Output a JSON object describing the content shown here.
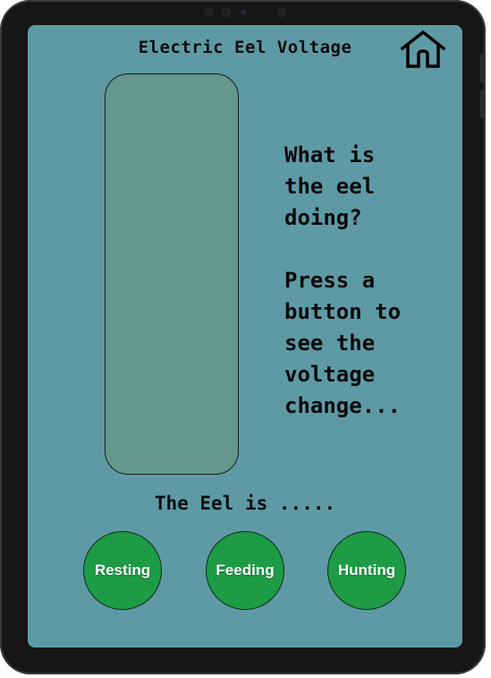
{
  "app": {
    "title": "Electric Eel Voltage",
    "home_icon": "home-icon"
  },
  "prompt": {
    "text": "What is\nthe eel\ndoing?\n\nPress a\nbutton to\nsee the\nvoltage\nchange..."
  },
  "status": {
    "text": "The Eel is ....."
  },
  "buttons": [
    {
      "label": "Resting"
    },
    {
      "label": "Feeding"
    },
    {
      "label": "Hunting"
    }
  ],
  "colors": {
    "screen_bg": "#5e9aa5",
    "meter_fill": "#64988a",
    "button_green": "#1d9b45",
    "device_frame": "#161616"
  }
}
